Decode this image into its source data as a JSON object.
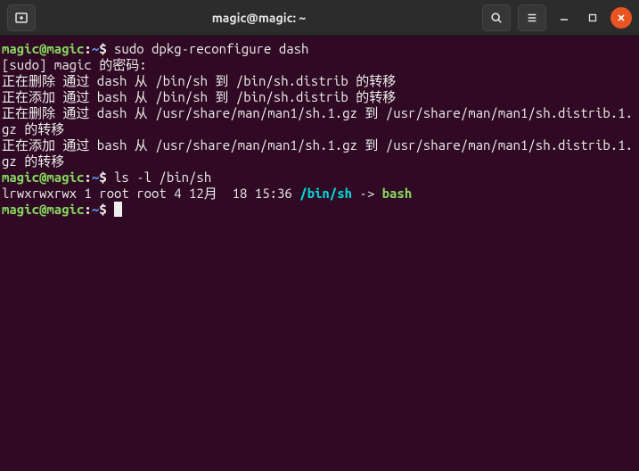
{
  "titlebar": {
    "title": "magic@magic: ~"
  },
  "terminal": {
    "prompt_user": "magic@magic",
    "prompt_sep": ":",
    "prompt_path": "~",
    "prompt_dollar": "$",
    "lines": {
      "cmd1": " sudo dpkg-reconfigure dash",
      "sudo_pw": "[sudo] magic 的密码: ",
      "l1": "正在删除 通过 dash 从 /bin/sh 到 /bin/sh.distrib 的转移",
      "l2": "正在添加 通过 bash 从 /bin/sh 到 /bin/sh.distrib 的转移",
      "l3": "正在删除 通过 dash 从 /usr/share/man/man1/sh.1.gz 到 /usr/share/man/man1/sh.distrib.1.gz 的转移",
      "l4": "正在添加 通过 bash 从 /usr/share/man/man1/sh.1.gz 到 /usr/share/man/man1/sh.distrib.1.gz 的转移",
      "cmd2": " ls -l /bin/sh",
      "ls_prefix": "lrwxrwxrwx 1 root root 4 12月  18 15:36 ",
      "ls_link": "/bin/sh",
      "ls_arrow": " -> ",
      "ls_target": "bash",
      "cmd3": " "
    }
  }
}
